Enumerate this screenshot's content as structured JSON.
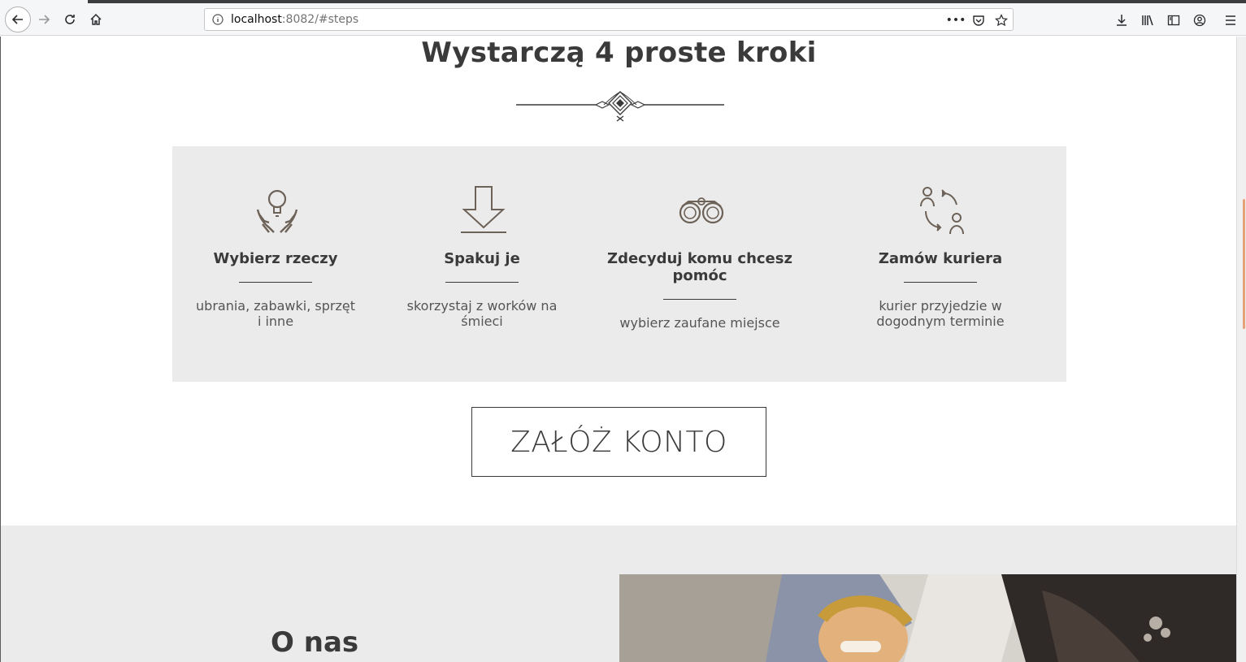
{
  "browser": {
    "url_host": "localhost",
    "url_rest": ":8082/#steps"
  },
  "steps_section": {
    "title": "Wystarczą 4 proste kroki",
    "steps": [
      {
        "title": "Wybierz rzeczy",
        "desc": "ubrania, zabawki, sprzęt i inne",
        "icon": "hands-lightbulb-icon"
      },
      {
        "title": "Spakuj je",
        "desc": "skorzystaj z worków na śmieci",
        "icon": "download-arrow-icon"
      },
      {
        "title": "Zdecyduj komu chcesz pomóc",
        "desc": "wybierz zaufane miejsce",
        "icon": "binoculars-icon"
      },
      {
        "title": "Zamów kuriera",
        "desc": "kurier przyjedzie w dogodnym terminie",
        "icon": "people-exchange-icon"
      }
    ],
    "cta_label": "ZAŁÓŻ KONTO"
  },
  "about_section": {
    "title": "O nas"
  },
  "colors": {
    "accent": "#e8a27a",
    "panel": "#ebebeb",
    "text": "#3a3a3a",
    "icon": "#6d6258"
  }
}
